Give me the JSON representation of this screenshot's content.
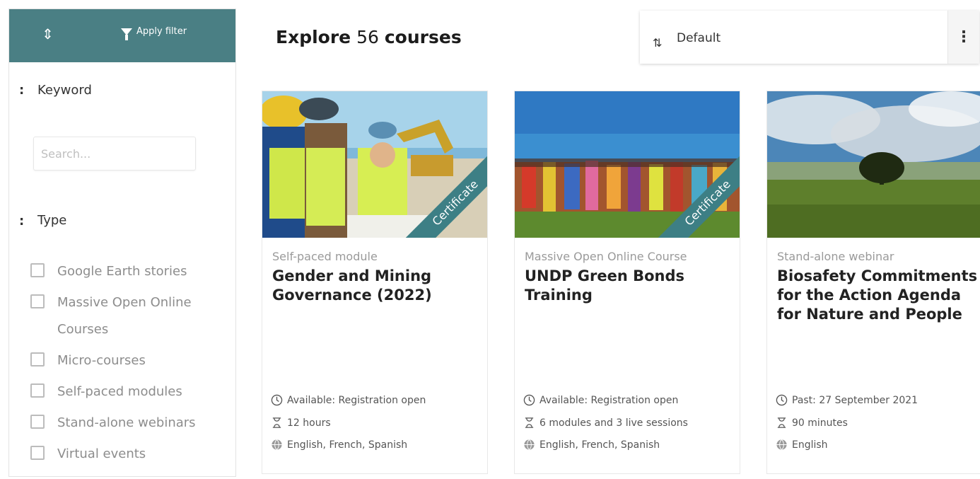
{
  "sidebar": {
    "apply_filter_label": "Apply filter",
    "keyword_label": "Keyword",
    "search_placeholder": "Search...",
    "type_label": "Type",
    "types": [
      {
        "label": "Google Earth stories"
      },
      {
        "label": "Massive Open Online Courses"
      },
      {
        "label": "Micro-courses"
      },
      {
        "label": "Self-paced modules"
      },
      {
        "label": "Stand-alone webinars"
      },
      {
        "label": "Virtual events"
      }
    ]
  },
  "header": {
    "explore_prefix": "Explore",
    "count": "56",
    "explore_suffix": "courses",
    "sort_value": "Default"
  },
  "colors": {
    "accent": "#4a7f84"
  },
  "courses": [
    {
      "type": "Self-paced module",
      "title": "Gender and Mining Governance (2022)",
      "badge": "Certificate",
      "availability": "Available: Registration open",
      "duration": "12 hours",
      "languages": "English, French, Spanish"
    },
    {
      "type": "Massive Open Online Course",
      "title": "UNDP Green Bonds Training",
      "badge": "Certificate",
      "availability": "Available: Registration open",
      "duration": "6 modules and 3 live sessions",
      "languages": "English, French, Spanish"
    },
    {
      "type": "Stand-alone webinar",
      "title": "Biosafety Commitments for the Action Agenda for Nature and People",
      "availability": "Past: 27 September 2021",
      "duration": "90 minutes",
      "languages": "English"
    }
  ]
}
